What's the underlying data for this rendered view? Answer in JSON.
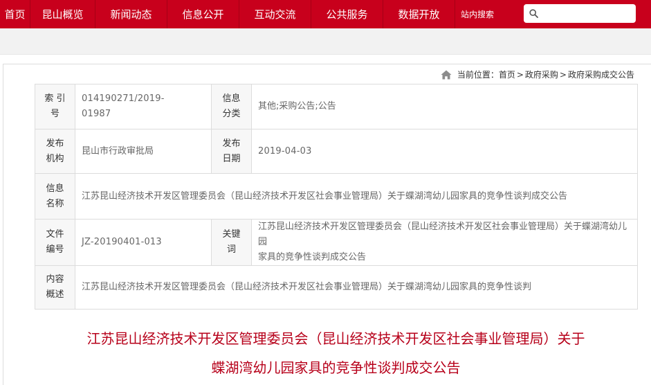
{
  "nav": {
    "items": [
      "首页",
      "昆山概览",
      "新闻动态",
      "信息公开",
      "互动交流",
      "公共服务",
      "数据开放"
    ],
    "search_label": "站内搜索",
    "search_placeholder": ""
  },
  "breadcrumb": {
    "prefix": "当前位置：",
    "items": [
      "首页",
      "政府采购",
      "政府采购成交公告"
    ],
    "separator": ">"
  },
  "info": {
    "index_label": "索 引\n号",
    "index_value": "014190271/2019-\n01987",
    "category_label": "信息\n分类",
    "category_value": "其他;采购公告;公告",
    "issuer_label": "发布\n机构",
    "issuer_value": "昆山市行政审批局",
    "date_label": "发布\n日期",
    "date_value": "2019-04-03",
    "name_label": "信息\n名称",
    "name_value": "江苏昆山经济技术开发区管理委员会（昆山经济技术开发区社会事业管理局）关于蝶湖湾幼儿园家具的竞争性谈判成交公告",
    "docno_label": "文件\n编号",
    "docno_value": "JZ-20190401-013",
    "keyword_label": "关键\n词",
    "keyword_value": "江苏昆山经济技术开发区管理委员会（昆山经济技术开发区社会事业管理局）关于蝶湖湾幼儿园\n家具的竞争性谈判成交公告",
    "summary_label": "内容\n概述",
    "summary_value": "江苏昆山经济技术开发区管理委员会（昆山经济技术开发区社会事业管理局）关于蝶湖湾幼儿园家具的竞争性谈判"
  },
  "article": {
    "title_line1": "江苏昆山经济技术开发区管理委员会（昆山经济技术开发区社会事业管理局）关于",
    "title_line2": "蝶湖湾幼儿园家具的竞争性谈判成交公告"
  },
  "colors": {
    "nav_bg": "#c8001c",
    "title": "#b7001a"
  }
}
